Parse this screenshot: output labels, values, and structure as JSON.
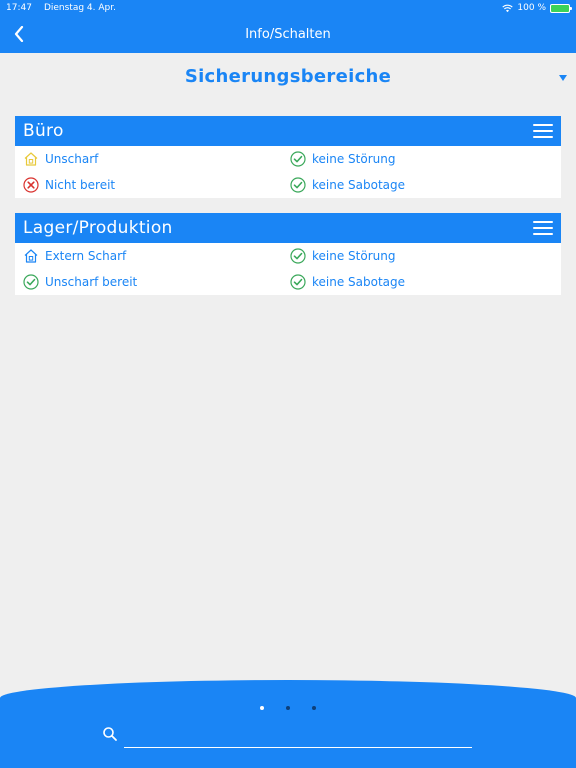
{
  "status_bar": {
    "time": "17:47",
    "date": "Dienstag 4. Apr.",
    "battery": "100 %"
  },
  "nav": {
    "title": "Info/Schalten",
    "back_icon": "chevron-left-icon"
  },
  "section": {
    "title": "Sicherungsbereiche",
    "filter_icon": "triangle-down-icon"
  },
  "areas": [
    {
      "name": "Büro",
      "status": [
        {
          "icon": "house-outline-icon",
          "color": "#e8c93a",
          "label": "Unscharf"
        },
        {
          "icon": "check-circle-icon",
          "color": "#3aa85a",
          "label": "keine Störung"
        },
        {
          "icon": "x-circle-icon",
          "color": "#d9322e",
          "label": "Nicht bereit"
        },
        {
          "icon": "check-circle-icon",
          "color": "#3aa85a",
          "label": "keine Sabotage"
        }
      ]
    },
    {
      "name": "Lager/Produktion",
      "status": [
        {
          "icon": "house-outline-icon",
          "color": "#1a85f5",
          "label": "Extern Scharf"
        },
        {
          "icon": "check-circle-icon",
          "color": "#3aa85a",
          "label": "keine Störung"
        },
        {
          "icon": "check-circle-icon",
          "color": "#3aa85a",
          "label": "Unscharf bereit"
        },
        {
          "icon": "check-circle-icon",
          "color": "#3aa85a",
          "label": "keine Sabotage"
        }
      ]
    }
  ],
  "pager": {
    "count": 3,
    "active": 0
  },
  "search": {
    "placeholder": ""
  },
  "colors": {
    "accent": "#1a85f5",
    "background": "#efefef"
  }
}
